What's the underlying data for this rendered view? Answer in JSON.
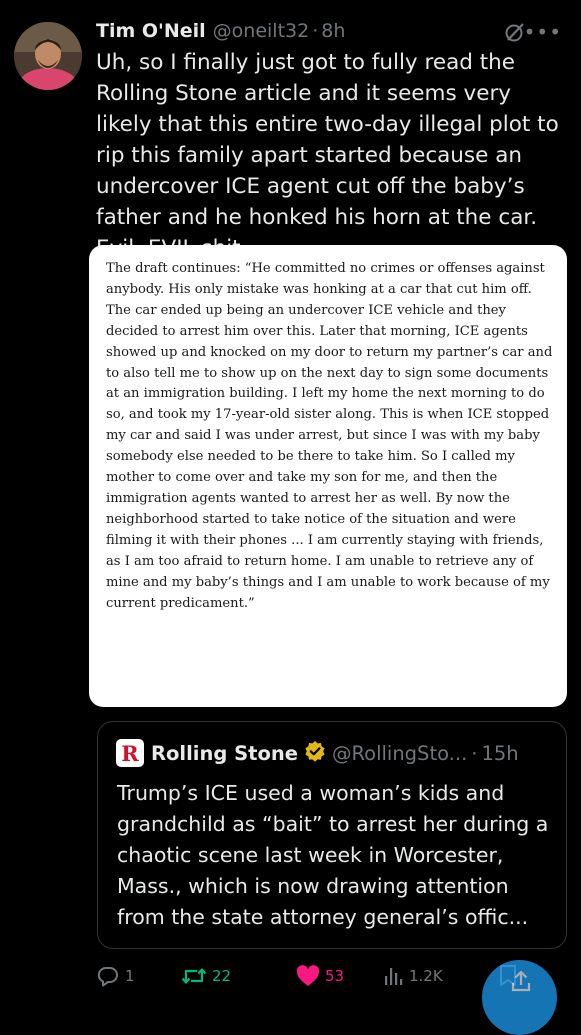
{
  "author": {
    "name": "Tim O'Neil",
    "handle": "@oneilt32",
    "separator": "·",
    "timestamp": "8h"
  },
  "tweet": {
    "text": "Uh, so I finally just got to fully read the Rolling Stone article and it seems very likely that this entire two-day illegal plot to rip this family apart started because an undercover ICE agent cut off the baby’s father and he honked his horn at the car. Evil, EVIL shit."
  },
  "attached_image": {
    "text": "The draft continues: “He committed no crimes or offenses against anybody. His only mistake was honking at a car that cut him off. The car ended up being an undercover ICE vehicle and they decided to arrest him over this. Later that morning, ICE agents showed up and knocked on my door to return my partner’s car and to also tell me to show up on the next day to sign some documents at an immigration building. I left my home the next morning to do so, and took my 17-year-old sister along. This is when ICE stopped my car and said I was under arrest, but since I was with my baby somebody else needed to be there to take him. So I called my mother to come over and take my son for me, and then the immigration agents wanted to arrest her as well. By now the neighborhood started to take notice of the situation and were filming it with their phones ... I am currently staying with friends, as I am too afraid to return home. I am unable to retrieve any of mine and my baby’s things and I am unable to work because of my current predicament.”"
  },
  "quoted_tweet": {
    "logo_letter": "R",
    "name": "Rolling Stone",
    "handle": "@RollingSto...",
    "separator": "·",
    "timestamp": "15h",
    "text": "Trump’s ICE used a woman’s kids and grandchild as “bait” to arrest her during a chaotic scene last week in Worcester, Mass., which is now drawing attention from the state attorney general’s offic..."
  },
  "actions": {
    "replies": "1",
    "reposts": "22",
    "likes": "53",
    "views": "1.2K"
  },
  "icons": {
    "more": "•••"
  },
  "colors": {
    "background": "#000000",
    "text": "#e7e9ea",
    "muted": "#71767b",
    "repost_green": "#00ba7c",
    "like_pink": "#f91880",
    "brand_blue": "#1d9bf0",
    "rolling_stone_red": "#d0112b",
    "verified_gold": "#e2b719"
  }
}
